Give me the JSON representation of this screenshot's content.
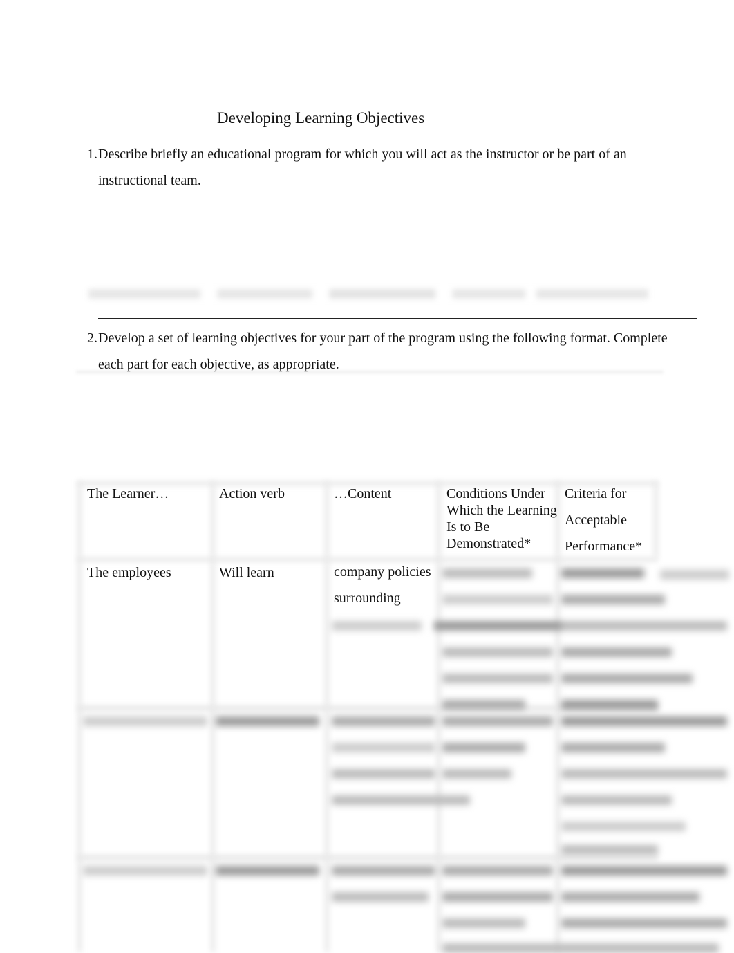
{
  "document": {
    "title": "Developing Learning Objectives",
    "questions": [
      {
        "number": "1.",
        "text_line1": "Describe briefly an educational program for which you will act as the instructor or be part of an",
        "text_line2": "instructional team."
      },
      {
        "number": "2.",
        "text_line1": "Develop a set of learning objectives for your part of the program using the following format. Complete",
        "text_line2": "each part for each objective, as appropriate."
      }
    ],
    "answer_1_status": "blurred",
    "table": {
      "headers": [
        "The Learner…",
        "Action verb",
        "…Content",
        [
          "Conditions Under",
          "Which the Learning",
          "Is to Be",
          "Demonstrated*"
        ],
        [
          "Criteria for",
          "Acceptable",
          "Performance*"
        ]
      ],
      "rows": [
        {
          "learner": "The employees",
          "action_verb": "Will learn",
          "content": [
            "company policies",
            "surrounding"
          ],
          "remaining_status": "blurred"
        },
        {
          "status": "blurred"
        },
        {
          "status": "blurred"
        }
      ]
    }
  }
}
